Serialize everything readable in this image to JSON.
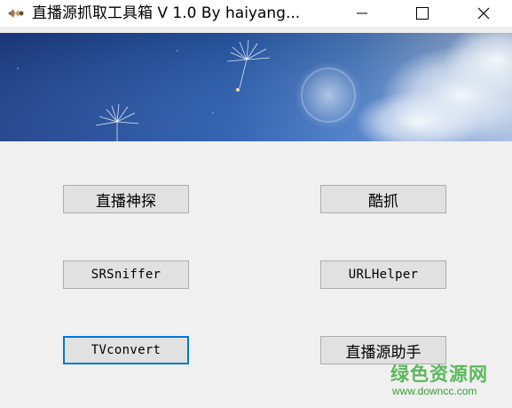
{
  "window": {
    "title": "直播源抓取工具箱  V 1.0   By haiyang..."
  },
  "buttons": {
    "zhibo_shentan": "直播神探",
    "kuzhua": "酷抓",
    "srsniffer": "SRSniffer",
    "urlhelper": "URLHelper",
    "tvconvert": "TVconvert",
    "zhiboyuan_zhushou": "直播源助手"
  },
  "watermark": {
    "site_name": "绿色资源网",
    "url": "www.downcc.com"
  },
  "colors": {
    "focus_border": "#0078d7",
    "button_bg": "#e1e1e1",
    "watermark_green": "#5cb85c"
  }
}
